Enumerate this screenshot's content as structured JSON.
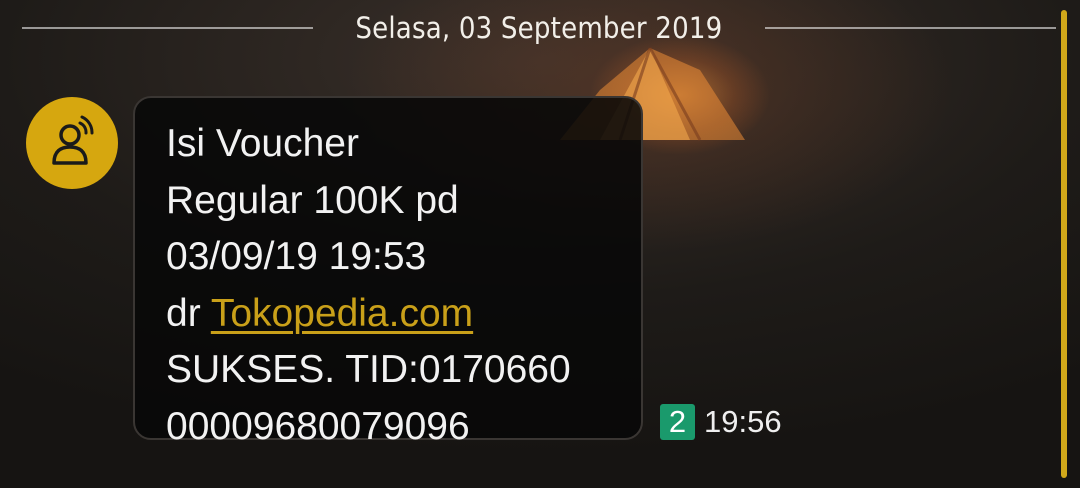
{
  "date_divider": {
    "label": "Selasa, 03 September 2019"
  },
  "sender": {
    "avatar_icon": "contact-person-icon",
    "avatar_color": "#d6a70f"
  },
  "message": {
    "line1": "Isi Voucher",
    "line2": "Regular 100K pd",
    "line3": "03/09/19 19:53",
    "line4_prefix": "dr ",
    "link_text": "Tokopedia.com",
    "line5": "SUKSES. TID:0170660",
    "line6": "00009680079096",
    "link_color": "#c9a019"
  },
  "meta": {
    "sim_slot": "2",
    "sim_color": "#1a9a6c",
    "time": "19:56"
  },
  "theme": {
    "accent": "#d1a81a"
  }
}
